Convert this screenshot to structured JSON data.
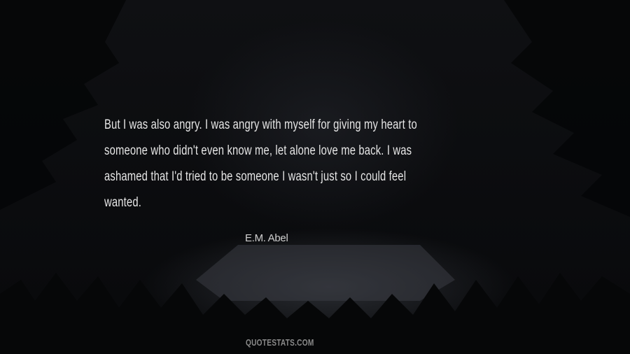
{
  "quote": {
    "lines": [
      "But I was also angry. I was angry with myself for giving my heart to",
      "someone who didn't even know me, let alone love me back. I was",
      "ashamed that I'd tried to be someone I wasn't just so I could feel",
      "wanted."
    ],
    "author": "E.M. Abel"
  },
  "footer": {
    "site": "QUOTESTATS.COM"
  },
  "colors": {
    "background": "#0b0c0f",
    "text": "#e6e6e6",
    "author": "#cfcfcf",
    "brand": "#8a8a8a"
  }
}
